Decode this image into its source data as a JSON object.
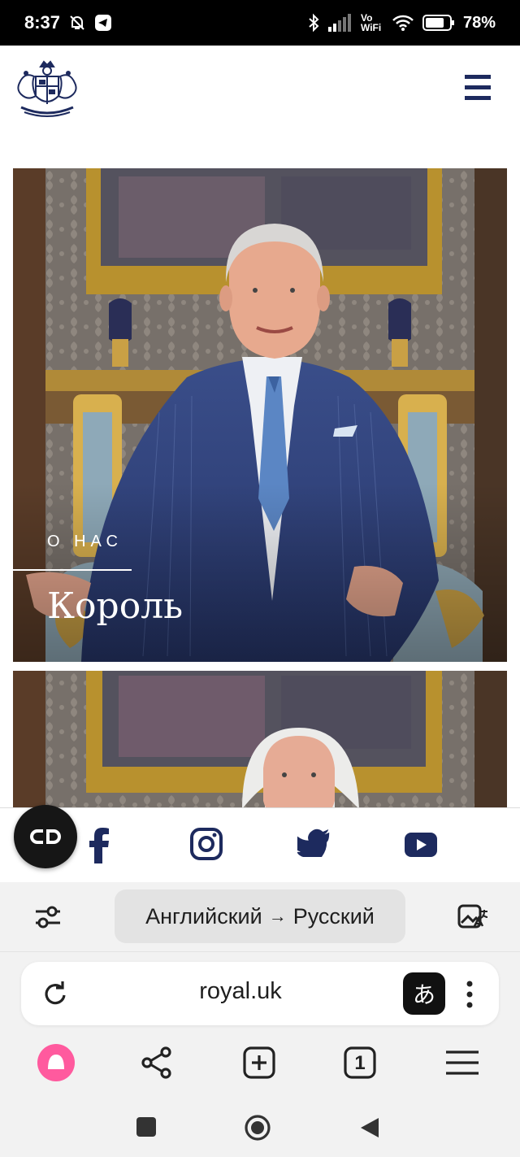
{
  "status_bar": {
    "time": "8:37",
    "network_label": "Vo WiFi",
    "battery": "78%"
  },
  "site": {
    "logo": "royal-coat-of-arms",
    "menu_icon": "hamburger-menu-icon"
  },
  "cards": [
    {
      "eyebrow": "О НАС",
      "title": "Король",
      "image": "portrait of the King seated in a blue pinstripe suit"
    },
    {
      "image": "portrait of the Queen"
    }
  ],
  "social": {
    "cookie_icon": "cookie-settings-icon",
    "links": [
      "facebook-icon",
      "instagram-icon",
      "twitter-icon",
      "youtube-icon"
    ]
  },
  "translate_bar": {
    "source_lang": "Английский",
    "arrow": "→",
    "target_lang": "Русский"
  },
  "browser": {
    "url": "royal.uk",
    "translate_badge": "あ",
    "tab_count": "1"
  },
  "colors": {
    "navy": "#1d2a5e",
    "alice_pink": "#ff5a9e",
    "dark": "#161616"
  }
}
